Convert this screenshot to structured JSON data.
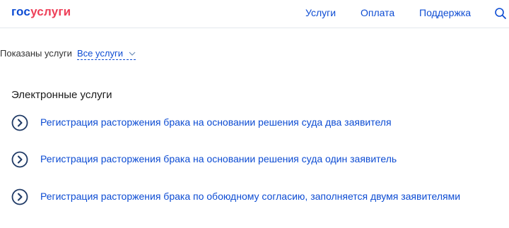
{
  "header": {
    "logo_part1": "гос",
    "logo_part2": "услуги",
    "nav": [
      {
        "label": "Услуги"
      },
      {
        "label": "Оплата"
      },
      {
        "label": "Поддержка"
      }
    ],
    "search_icon": "search-icon"
  },
  "filter": {
    "label": "Показаны услуги",
    "selected": "Все услуги"
  },
  "section": {
    "title": "Электронные услуги",
    "items": [
      {
        "label": "Регистрация расторжения брака на основании решения суда два заявителя"
      },
      {
        "label": "Регистрация расторжения брака на основании решения суда один заявитель"
      },
      {
        "label": "Регистрация расторжения брака по обоюдному согласию, заполняется двумя заявителями"
      }
    ]
  },
  "colors": {
    "accent": "#0d4cd3",
    "logo_accent": "#ee3f58",
    "icon_ring": "#1f3a66"
  }
}
